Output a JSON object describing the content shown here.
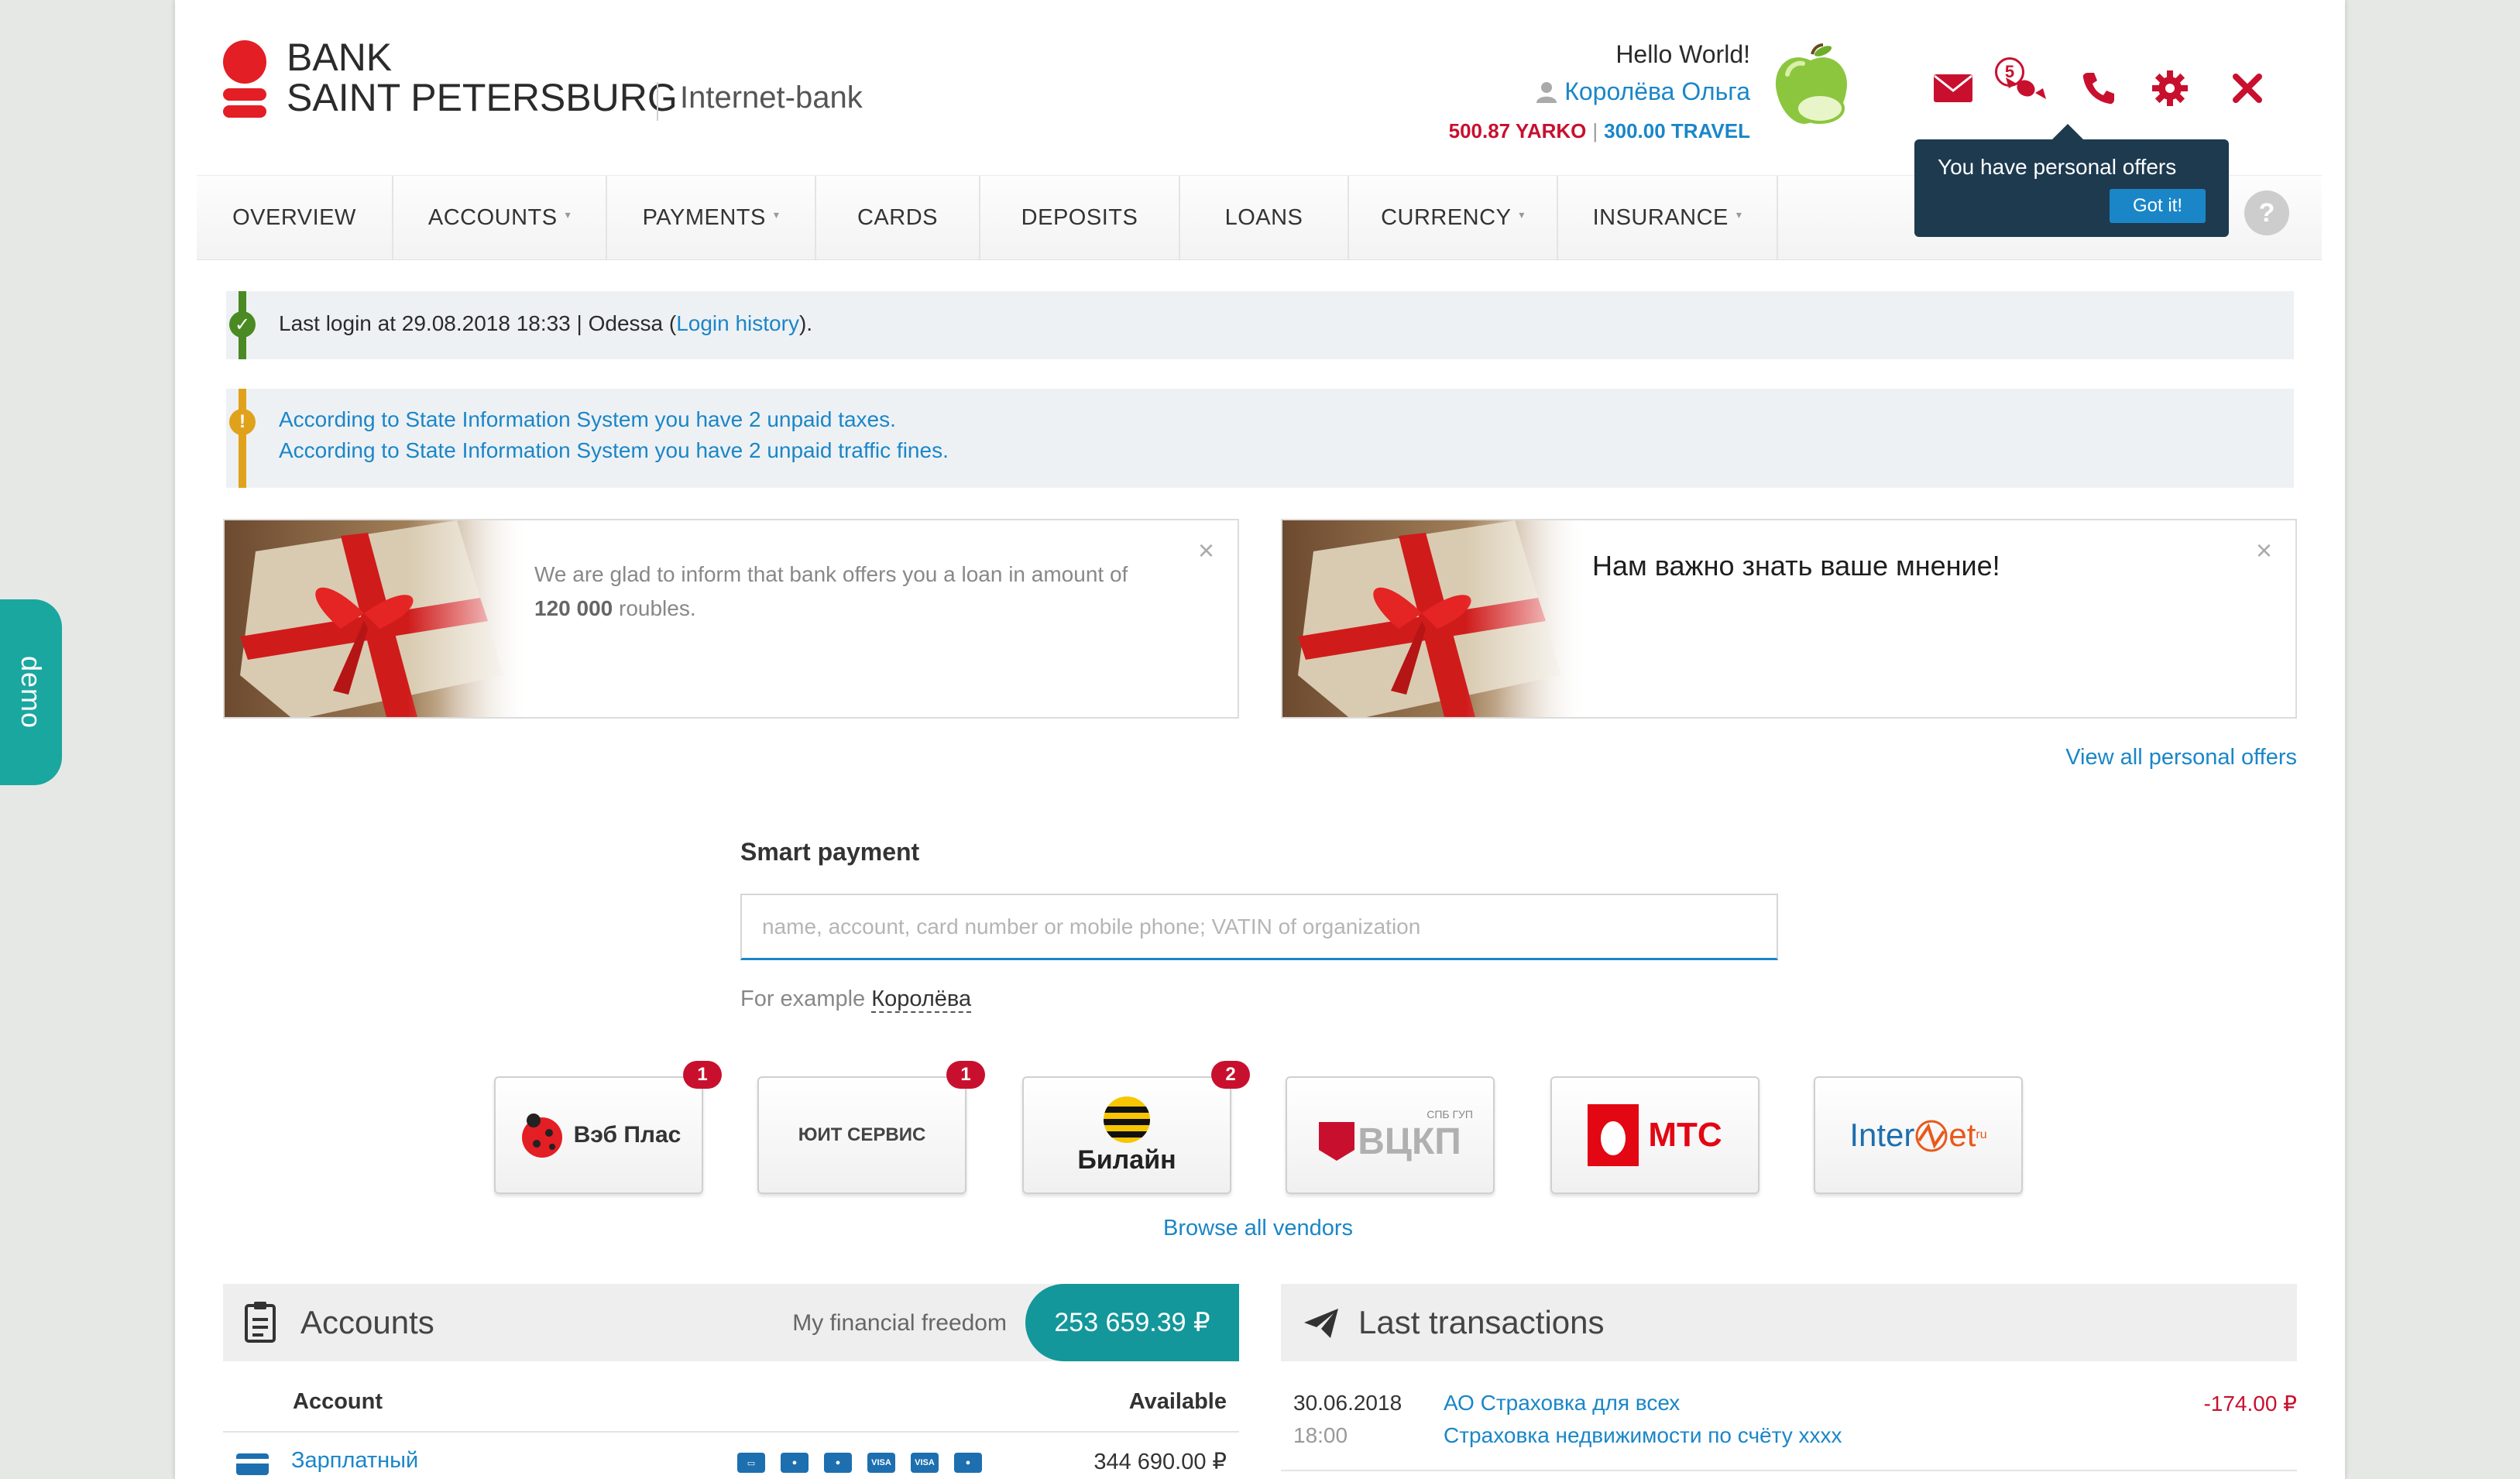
{
  "demo_label": "demo",
  "brand": {
    "line1": "BANK",
    "line2": "SAINT PETERSBURG",
    "subtitle": "Internet-bank",
    "accent": "#c8102e"
  },
  "user": {
    "greeting": "Hello World!",
    "name": "Королёва Ольга",
    "balance1": "500.87 YARKO",
    "balance_sep": "|",
    "balance2": "300.00 TRAVEL"
  },
  "header_icons": {
    "mail_badge": "5",
    "icons": [
      "mail-icon",
      "candy-icon",
      "phone-icon",
      "gear-icon",
      "close-icon"
    ]
  },
  "tooltip": {
    "text": "You have personal offers",
    "button": "Got it!"
  },
  "nav": [
    {
      "label": "OVERVIEW",
      "caret": ""
    },
    {
      "label": "ACCOUNTS",
      "caret": "▾"
    },
    {
      "label": "PAYMENTS",
      "caret": "▾"
    },
    {
      "label": "CARDS",
      "caret": ""
    },
    {
      "label": "DEPOSITS",
      "caret": ""
    },
    {
      "label": "LOANS",
      "caret": ""
    },
    {
      "label": "CURRENCY",
      "caret": "▾"
    },
    {
      "label": "INSURANCE",
      "caret": "▾"
    }
  ],
  "help_label": "?",
  "alerts": {
    "login": {
      "prefix": "Last login at 29.08.2018 18:33 | Odessa (",
      "link": "Login history",
      "suffix": ")."
    },
    "taxes": "According to State Information System you have 2 unpaid taxes.",
    "fines": "According to State Information System you have 2 unpaid traffic fines."
  },
  "offers": {
    "loan_text": "We are glad to inform that bank offers you a loan in amount of",
    "loan_amount": "120 000",
    "loan_suffix": "roubles.",
    "feedback": "Нам важно знать ваше мнение!",
    "close": "×",
    "view_all": "View all personal offers"
  },
  "smart_payment": {
    "title": "Smart payment",
    "placeholder": "name, account, card number or mobile phone; VATIN of organization",
    "example_label": "For example",
    "example_value": "Королёва"
  },
  "vendors": [
    {
      "name": "Вэб Плас",
      "badge": "1"
    },
    {
      "name": "ЮИТ СЕРВИС",
      "badge": "1"
    },
    {
      "name": "Билайн",
      "badge": "2"
    },
    {
      "name": "ВЦКП",
      "badge": ""
    },
    {
      "name": "МТС",
      "badge": ""
    },
    {
      "name": "Inter",
      "badge": ""
    }
  ],
  "vendor_extra": {
    "vckp_top": "СПБ ГУП",
    "internet_tail": "et",
    "internet_sup": "ru"
  },
  "browse_all": "Browse all vendors",
  "accounts": {
    "title": "Accounts",
    "freedom_label": "My financial freedom",
    "freedom_value": "253 659.39 ₽",
    "col_account": "Account",
    "col_available": "Available",
    "row_name": "Зарплатный",
    "row_value": "344 690.00 ₽"
  },
  "transactions": {
    "title": "Last transactions",
    "date": "30.06.2018",
    "time": "18:00",
    "payee": "АО Страховка для всех",
    "desc": "Страховка недвижимости по счёту хххх",
    "amount": "-174.00 ₽"
  }
}
